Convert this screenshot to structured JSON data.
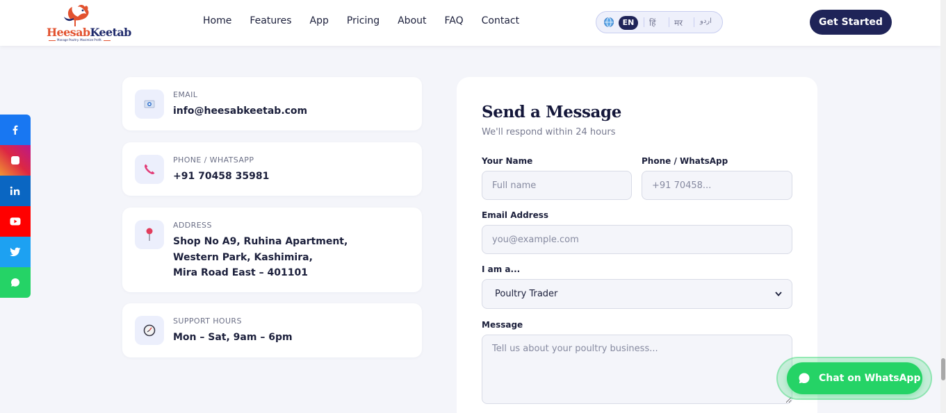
{
  "header": {
    "logo": {
      "part1": "Heesab",
      "part2": "Keetab",
      "tagline": "Manage Poultry. Maximize Profit."
    },
    "nav": [
      "Home",
      "Features",
      "App",
      "Pricing",
      "About",
      "FAQ",
      "Contact"
    ],
    "lang": {
      "active": "EN",
      "options": [
        "हिं",
        "मर",
        "اردو"
      ]
    },
    "cta": "Get Started"
  },
  "social": [
    {
      "name": "facebook",
      "glyph": "f",
      "color": "#1877f2"
    },
    {
      "name": "instagram",
      "glyph": "◘",
      "color": "#dc2743"
    },
    {
      "name": "linkedin",
      "glyph": "in",
      "color": "#0a66c2"
    },
    {
      "name": "youtube",
      "glyph": "▶",
      "color": "#ff0000"
    },
    {
      "name": "twitter",
      "glyph": "t",
      "color": "#1da1f2"
    },
    {
      "name": "whatsapp",
      "glyph": "◉",
      "color": "#25d366"
    }
  ],
  "contact": {
    "email": {
      "label": "EMAIL",
      "value": "info@heesabkeetab.com"
    },
    "phone": {
      "label": "PHONE / WHATSAPP",
      "value": "+91 70458 35981"
    },
    "address": {
      "label": "ADDRESS",
      "line1": "Shop No A9, Ruhina Apartment,",
      "line2": "Western Park, Kashimira,",
      "line3": "Mira Road East – 401101"
    },
    "hours": {
      "label": "SUPPORT HOURS",
      "value": "Mon – Sat, 9am – 6pm"
    }
  },
  "form": {
    "title": "Send a Message",
    "subtitle": "We'll respond within 24 hours",
    "name_label": "Your Name",
    "name_placeholder": "Full name",
    "phone_label": "Phone / WhatsApp",
    "phone_placeholder": "+91 70458...",
    "email_label": "Email Address",
    "email_placeholder": "you@example.com",
    "role_label": "I am a...",
    "role_value": "Poultry Trader",
    "message_label": "Message",
    "message_placeholder": "Tell us about your poultry business..."
  },
  "whatsapp_chat": "Chat on WhatsApp"
}
